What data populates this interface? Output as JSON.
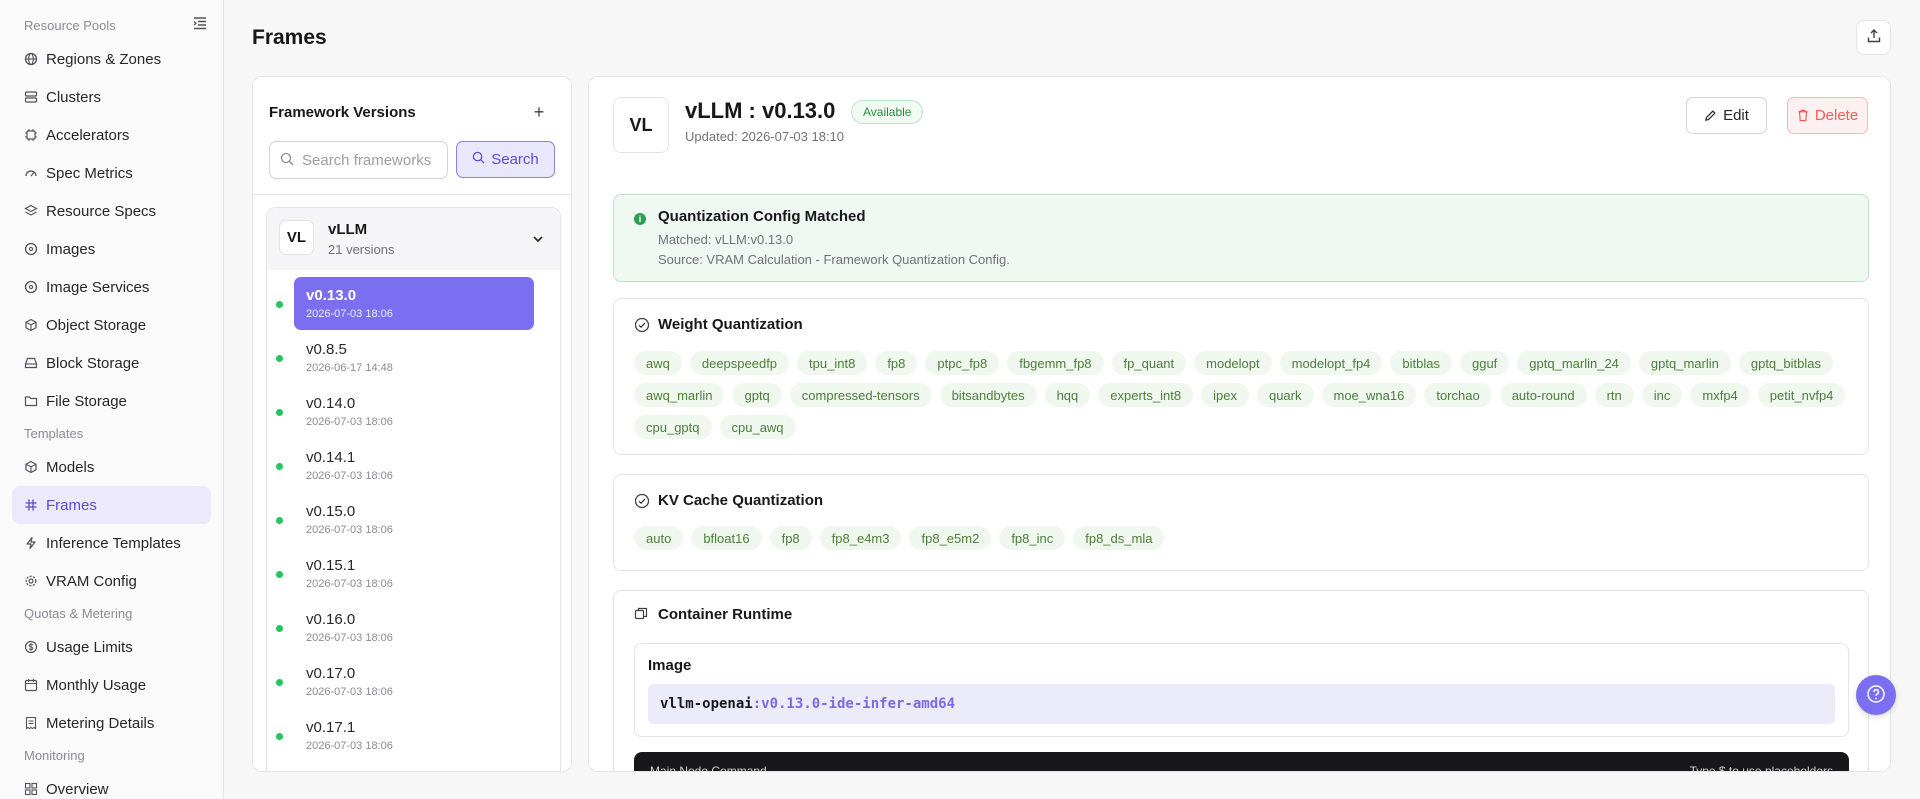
{
  "sidebar": {
    "sections": [
      "Resource Pools",
      "Templates",
      "Quotas & Metering",
      "Monitoring"
    ],
    "items": [
      {
        "label": "Regions & Zones",
        "icon": "globe-icon"
      },
      {
        "label": "Clusters",
        "icon": "server-icon"
      },
      {
        "label": "Accelerators",
        "icon": "chip-icon"
      },
      {
        "label": "Spec Metrics",
        "icon": "gauge-icon"
      },
      {
        "label": "Resource Specs",
        "icon": "layers-icon"
      },
      {
        "label": "Images",
        "icon": "disc-icon"
      },
      {
        "label": "Image Services",
        "icon": "disc-icon"
      },
      {
        "label": "Object Storage",
        "icon": "box-icon"
      },
      {
        "label": "Block Storage",
        "icon": "drive-icon"
      },
      {
        "label": "File Storage",
        "icon": "folder-icon"
      },
      {
        "label": "Models",
        "icon": "cube-icon"
      },
      {
        "label": "Frames",
        "icon": "hash-icon"
      },
      {
        "label": "Inference Templates",
        "icon": "zap-icon"
      },
      {
        "label": "VRAM Config",
        "icon": "gear-icon"
      },
      {
        "label": "Usage Limits",
        "icon": "dollar-icon"
      },
      {
        "label": "Monthly Usage",
        "icon": "calendar-icon"
      },
      {
        "label": "Metering Details",
        "icon": "receipt-icon"
      },
      {
        "label": "Overview",
        "icon": "grid-icon"
      }
    ]
  },
  "page": {
    "title": "Frames"
  },
  "framework_panel": {
    "title": "Framework Versions",
    "search_placeholder": "Search frameworks",
    "search_button": "Search",
    "group": {
      "avatar": "VL",
      "name": "vLLM",
      "count": "21 versions"
    },
    "versions": [
      {
        "name": "v0.13.0",
        "date": "2026-07-03 18:06"
      },
      {
        "name": "v0.8.5",
        "date": "2026-06-17 14:48"
      },
      {
        "name": "v0.14.0",
        "date": "2026-07-03 18:06"
      },
      {
        "name": "v0.14.1",
        "date": "2026-07-03 18:06"
      },
      {
        "name": "v0.15.0",
        "date": "2026-07-03 18:06"
      },
      {
        "name": "v0.15.1",
        "date": "2026-07-03 18:06"
      },
      {
        "name": "v0.16.0",
        "date": "2026-07-03 18:06"
      },
      {
        "name": "v0.17.0",
        "date": "2026-07-03 18:06"
      },
      {
        "name": "v0.17.1",
        "date": "2026-07-03 18:06"
      }
    ],
    "selected_version": "v0.13.0"
  },
  "detail": {
    "avatar": "VL",
    "title": "vLLM : v0.13.0",
    "status": "Available",
    "updated": "Updated: 2026-07-03 18:10",
    "edit_label": "Edit",
    "delete_label": "Delete",
    "match": {
      "title": "Quantization Config Matched",
      "line1": "Matched: vLLM:v0.13.0",
      "line2": "Source: VRAM Calculation - Framework Quantization Config."
    },
    "weight_quant": {
      "title": "Weight Quantization",
      "tags": [
        "awq",
        "deepspeedfp",
        "tpu_int8",
        "fp8",
        "ptpc_fp8",
        "fbgemm_fp8",
        "fp_quant",
        "modelopt",
        "modelopt_fp4",
        "bitblas",
        "gguf",
        "gptq_marlin_24",
        "gptq_marlin",
        "gptq_bitblas",
        "awq_marlin",
        "gptq",
        "compressed-tensors",
        "bitsandbytes",
        "hqq",
        "experts_int8",
        "ipex",
        "quark",
        "moe_wna16",
        "torchao",
        "auto-round",
        "rtn",
        "inc",
        "mxfp4",
        "petit_nvfp4",
        "cpu_gptq",
        "cpu_awq"
      ]
    },
    "kv_quant": {
      "title": "KV Cache Quantization",
      "tags": [
        "auto",
        "bfloat16",
        "fp8",
        "fp8_e4m3",
        "fp8_e5m2",
        "fp8_inc",
        "fp8_ds_mla"
      ]
    },
    "runtime": {
      "title": "Container Runtime",
      "image_label": "Image",
      "image_name": "vllm-openai",
      "image_tag": ":v0.13.0-ide-infer-amd64",
      "command_label": "Main Node Command",
      "command_hint": "Type $ to use placeholders"
    }
  },
  "colors": {
    "accent": "#7b6ef0",
    "success": "#2f9e55",
    "danger": "#ef5a5a"
  }
}
